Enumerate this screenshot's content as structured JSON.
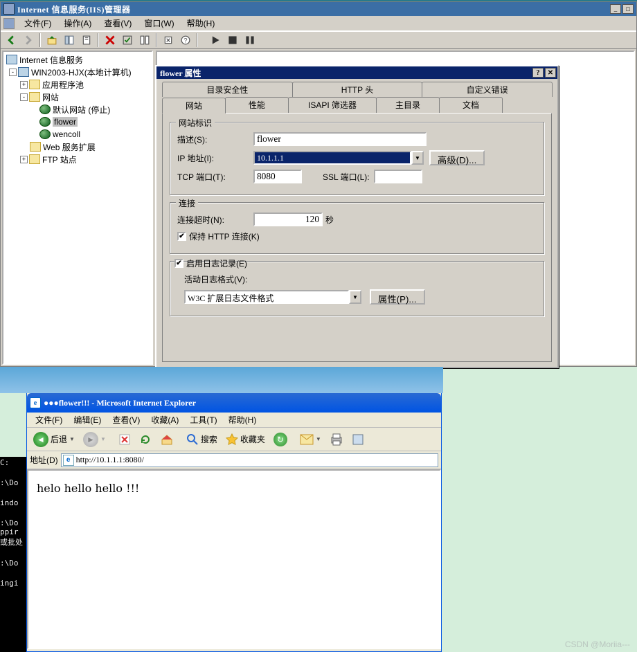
{
  "iis": {
    "title": "Internet 信息服务(IIS)管理器",
    "menus": [
      "文件(F)",
      "操作(A)",
      "查看(V)",
      "窗口(W)",
      "帮助(H)"
    ],
    "tree": {
      "root": "Internet 信息服务",
      "server": "WIN2003-HJX(本地计算机)",
      "appPool": "应用程序池",
      "sites": "网站",
      "site_default": "默认网站 (停止)",
      "site_flower": "flower",
      "site_wencoll": "wencoll",
      "webext": "Web 服务扩展",
      "ftp": "FTP 站点"
    }
  },
  "dlg": {
    "title": "flower 属性",
    "tabs_r1": [
      "目录安全性",
      "HTTP 头",
      "自定义错误"
    ],
    "tabs_r2": [
      "网站",
      "性能",
      "ISAPI 筛选器",
      "主目录",
      "文档"
    ],
    "group_ident": "网站标识",
    "lbl_desc": "描述(S):",
    "val_desc": "flower",
    "lbl_ip": "IP 地址(I):",
    "val_ip": "10.1.1.1",
    "btn_adv": "高级(D)...",
    "lbl_tcp": "TCP 端口(T):",
    "val_tcp": "8080",
    "lbl_ssl": "SSL 端口(L):",
    "val_ssl": "",
    "group_conn": "连接",
    "lbl_timeout": "连接超时(N):",
    "val_timeout": "120",
    "lbl_sec": "秒",
    "chk_keep": "保持 HTTP 连接(K)",
    "chk_log": "启用日志记录(E)",
    "lbl_logfmt": "活动日志格式(V):",
    "val_logfmt": "W3C 扩展日志文件格式",
    "btn_prop": "属性(P)..."
  },
  "ie": {
    "title": "●●●flower!!! - Microsoft Internet Explorer",
    "menus": [
      "文件(F)",
      "编辑(E)",
      "查看(V)",
      "收藏(A)",
      "工具(T)",
      "帮助(H)"
    ],
    "btn_back": "后退",
    "btn_search": "搜索",
    "btn_fav": "收藏夹",
    "addr_label": "地址(D)",
    "url": "http://10.1.1.1:8080/",
    "page_text": "helo hello hello !!!"
  },
  "cmd": {
    "lines": [
      "C:",
      "",
      ":\\Do",
      "",
      "indo",
      "",
      ":\\Do",
      "ppir",
      "或批处",
      "",
      ":\\Do",
      "",
      "ingi"
    ]
  },
  "watermark": "CSDN @Moriia---"
}
